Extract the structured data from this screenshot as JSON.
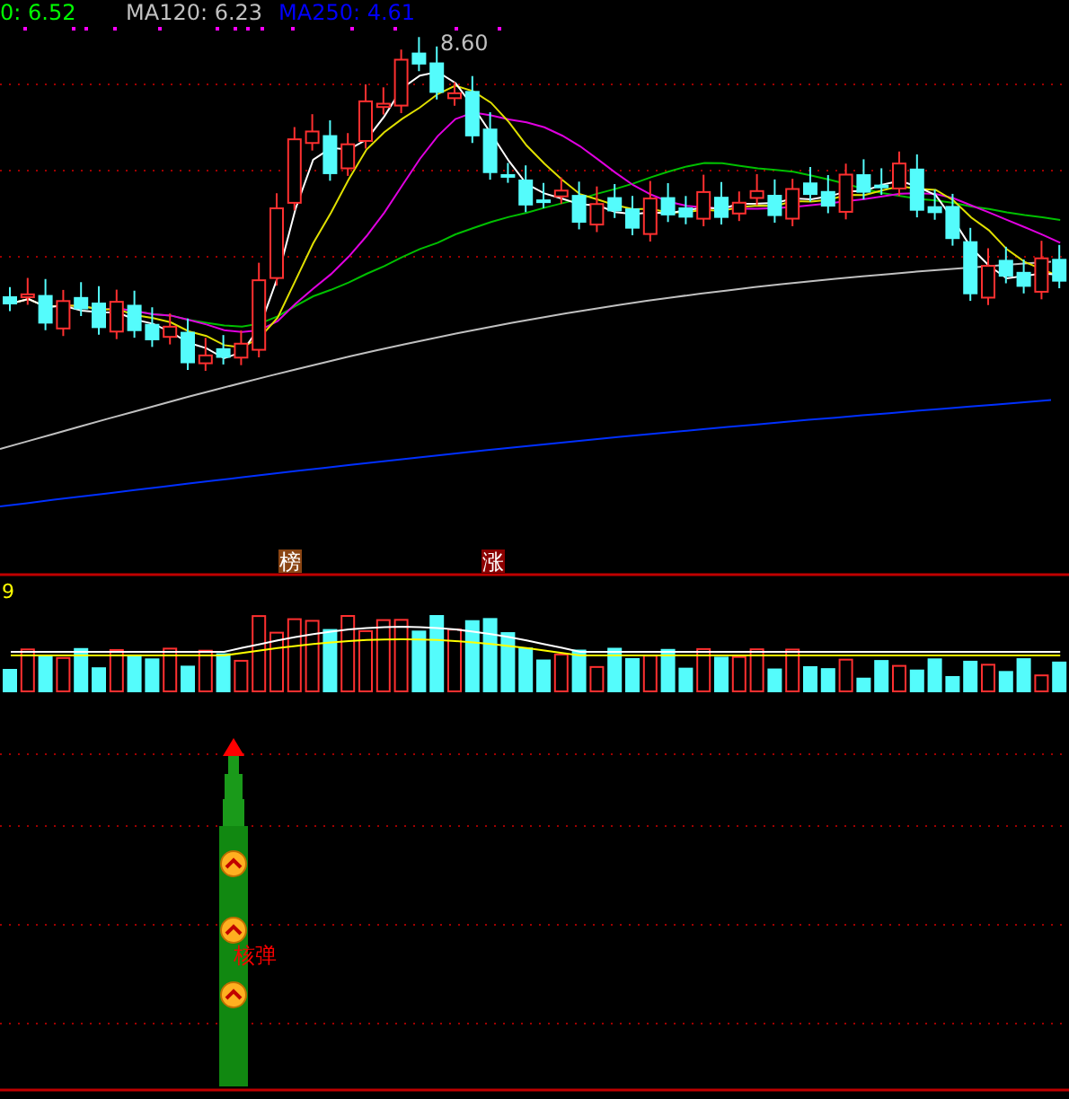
{
  "price_legend": [
    {
      "label": "0: 6.52",
      "color": "#00ff00"
    },
    {
      "label": "MA120: 6.23",
      "color": "#c0c0c0"
    },
    {
      "label": "MA250: 4.61",
      "color": "#0000ff"
    }
  ],
  "high_label": "8.60",
  "badges": [
    {
      "label": "榜",
      "color": "#8b4513"
    },
    {
      "label": "涨",
      "color": "#8b0000"
    }
  ],
  "volume_label": "9",
  "signal_text": "核弹"
}
